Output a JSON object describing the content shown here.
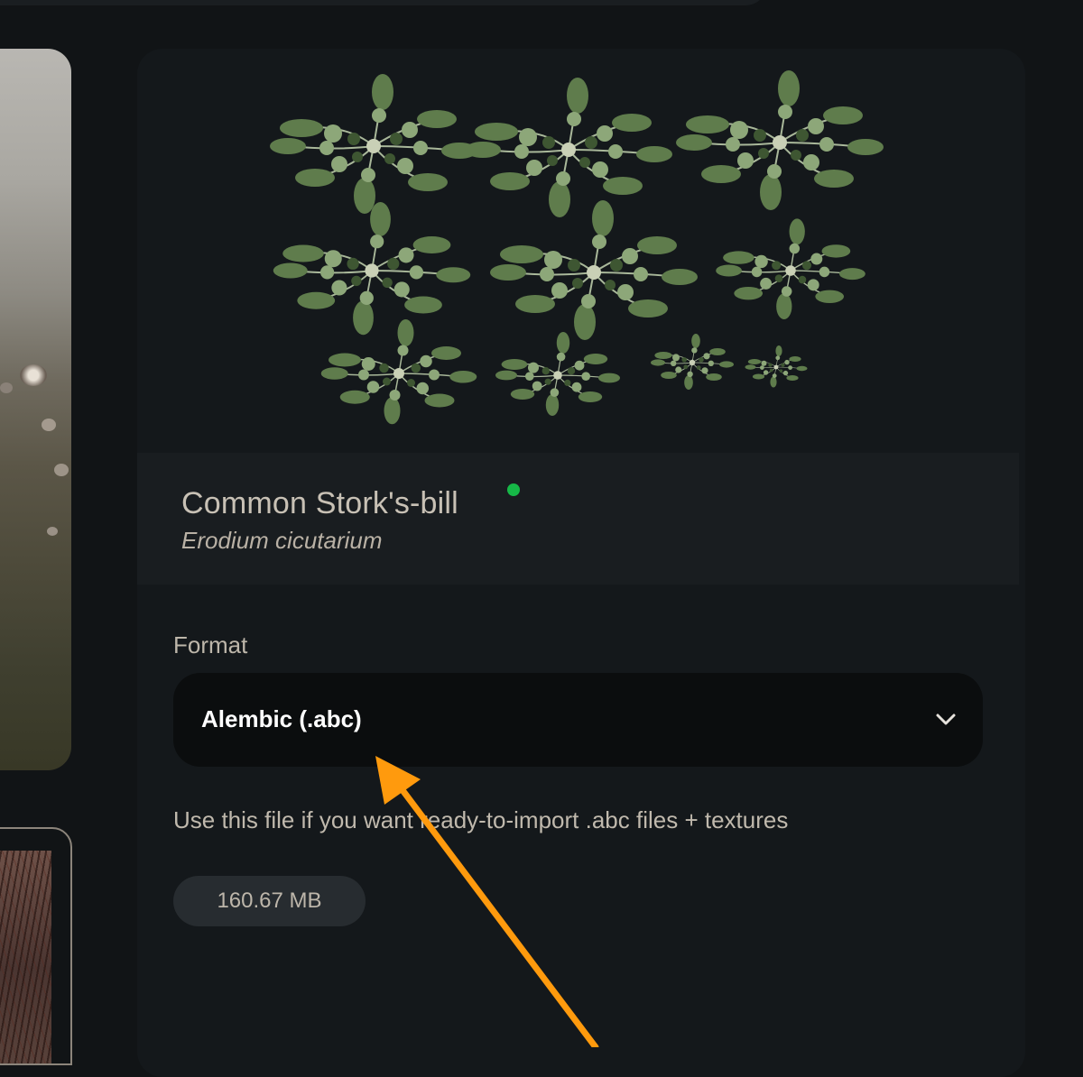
{
  "asset": {
    "common_name": "Common Stork's-bill",
    "latin_name": "Erodium cicutarium",
    "status_color": "#16b847"
  },
  "download": {
    "format_label": "Format",
    "format_value": "Alembic (.abc)",
    "description": "Use this file if you want ready-to-import .abc files + textures",
    "file_size": "160.67 MB"
  },
  "icons": {
    "select_chevron": "chevron-down-icon"
  },
  "colors": {
    "background": "#111416",
    "card": "#14181b",
    "annotation_arrow": "#ff9a0d"
  }
}
